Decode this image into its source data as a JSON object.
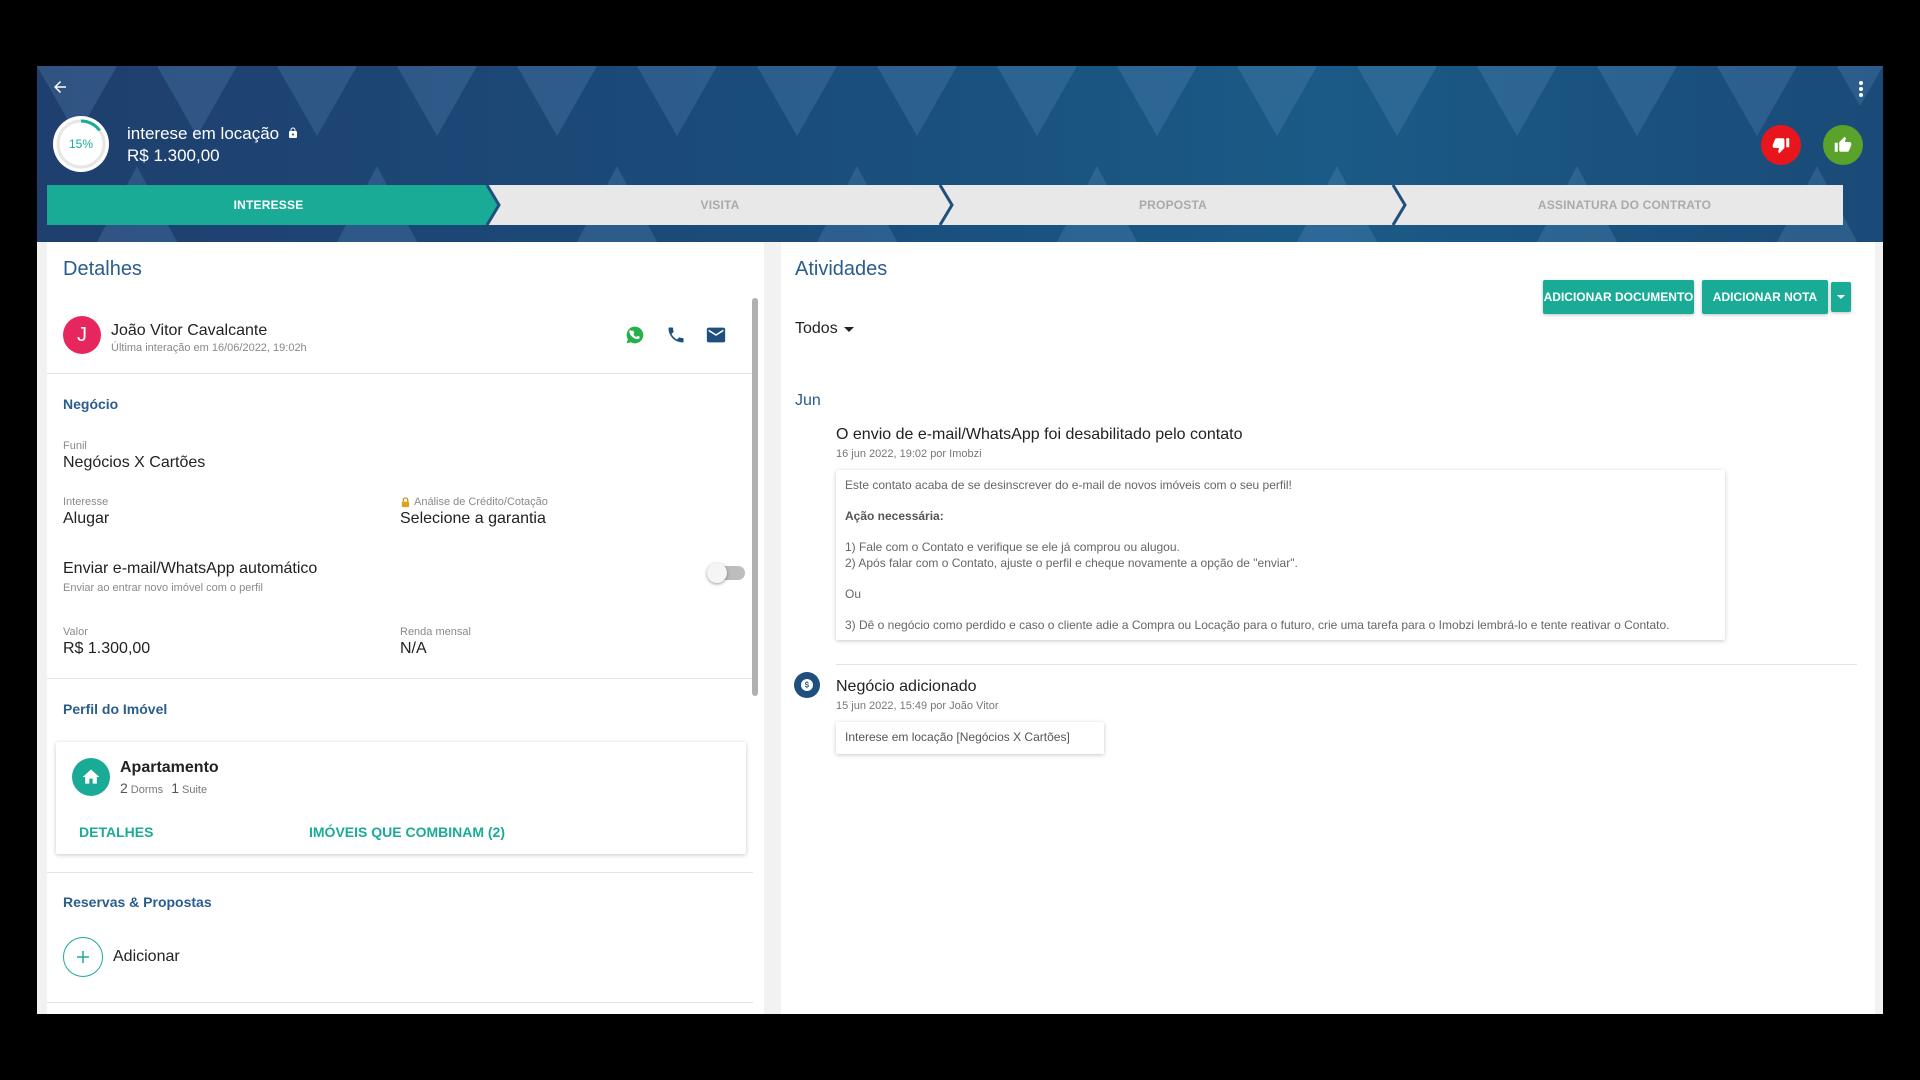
{
  "header": {
    "progress_label": "15%",
    "progress_value": 0.15,
    "deal_title": "interese em locação",
    "deal_value": "R$ 1.300,00",
    "stages": [
      {
        "label": "INTERESSE",
        "active": true
      },
      {
        "label": "VISITA",
        "active": false
      },
      {
        "label": "PROPOSTA",
        "active": false
      },
      {
        "label": "ASSINATURA DO CONTRATO",
        "active": false
      }
    ],
    "colors": {
      "lose": "#e8161c",
      "win": "#5aa22a",
      "accent": "#1aab96"
    }
  },
  "details": {
    "title": "Detalhes",
    "contact": {
      "initial": "J",
      "name": "João Vitor Cavalcante",
      "last_interaction": "Última interação em 16/06/2022, 19:02h"
    },
    "business": {
      "section_label": "Negócio",
      "funnel_label": "Funil",
      "funnel_value": "Negócios X Cartões",
      "interest_label": "Interesse",
      "interest_value": "Alugar",
      "credit_label": "Análise de Crédito/Cotação",
      "credit_value": "Selecione a garantia",
      "auto_send_label": "Enviar e-mail/WhatsApp automático",
      "auto_send_sub": "Enviar ao entrar novo imóvel com o perfil",
      "value_label": "Valor",
      "value_value": "R$ 1.300,00",
      "income_label": "Renda mensal",
      "income_value": "N/A"
    },
    "property_profile": {
      "section_label": "Perfil do Imóvel",
      "type": "Apartamento",
      "dorms_count": "2",
      "dorms_unit": "Dorms",
      "suite_count": "1",
      "suite_unit": "Suite",
      "details_link": "DETALHES",
      "matches_link": "IMÓVEIS QUE COMBINAM (2)"
    },
    "reservations": {
      "section_label": "Reservas & Propostas",
      "add_label": "Adicionar"
    }
  },
  "activities": {
    "title": "Atividades",
    "add_document": "ADICIONAR DOCUMENTO",
    "add_note": "ADICIONAR NOTA",
    "filter": "Todos",
    "month": "Jun",
    "items": [
      {
        "title": "O envio de e-mail/WhatsApp foi desabilitado pelo contato",
        "meta": "16 jun 2022, 19:02 por Imobzi",
        "lines": [
          "Este contato acaba de se desinscrever do e-mail de novos imóveis com o seu perfil!",
          "",
          "Ação necessária:",
          "",
          "1) Fale com o Contato e verifique se ele já comprou ou alugou.",
          "2) Após falar com o Contato, ajuste o perfil e cheque novamente a opção de \"enviar\".",
          "",
          "Ou",
          "",
          "3) Dê o negócio como perdido e caso o cliente adie a Compra ou Locação para o futuro, crie uma tarefa para o Imobzi lembrá-lo e tente reativar o Contato."
        ]
      },
      {
        "title": "Negócio adicionado",
        "meta": "15 jun 2022, 15:49 por João Vitor",
        "body": "Interese em locação [Negócios X Cartões]"
      }
    ]
  }
}
